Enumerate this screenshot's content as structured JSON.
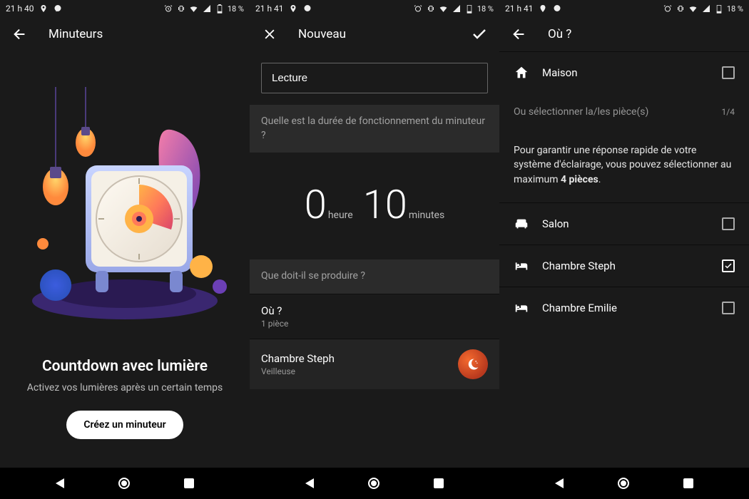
{
  "status": {
    "times": [
      "21 h 40",
      "21 h 41",
      "21 h 41"
    ],
    "battery": "18 %"
  },
  "screen1": {
    "title": "Minuteurs",
    "headline": "Countdown avec lumière",
    "sub": "Activez vos lumières après un certain temps",
    "cta": "Créez un minuteur"
  },
  "screen2": {
    "title": "Nouveau",
    "input_value": "Lecture",
    "duration_q": "Quelle est la durée de fonctionnement du minuteur ?",
    "hours": "0",
    "hours_unit": "heure",
    "minutes": "10",
    "minutes_unit": "minutes",
    "action_q": "Que doit-il se produire ?",
    "where_label": "Où ?",
    "where_sub": "1 pièce",
    "room": "Chambre Steph",
    "room_sub": "Veilleuse"
  },
  "screen3": {
    "title": "Où ?",
    "home": "Maison",
    "select_label": "Ou sélectionner la/les pièce(s)",
    "count": "1/4",
    "info_a": "Pour garantir une réponse rapide de votre système d'éclairage, vous pouvez sélectionner au maximum ",
    "info_b": "4 pièces",
    "info_c": ".",
    "rooms": [
      {
        "name": "Salon",
        "checked": false,
        "icon": "sofa"
      },
      {
        "name": "Chambre Steph",
        "checked": true,
        "icon": "bed"
      },
      {
        "name": "Chambre Emilie",
        "checked": false,
        "icon": "bed"
      }
    ]
  }
}
